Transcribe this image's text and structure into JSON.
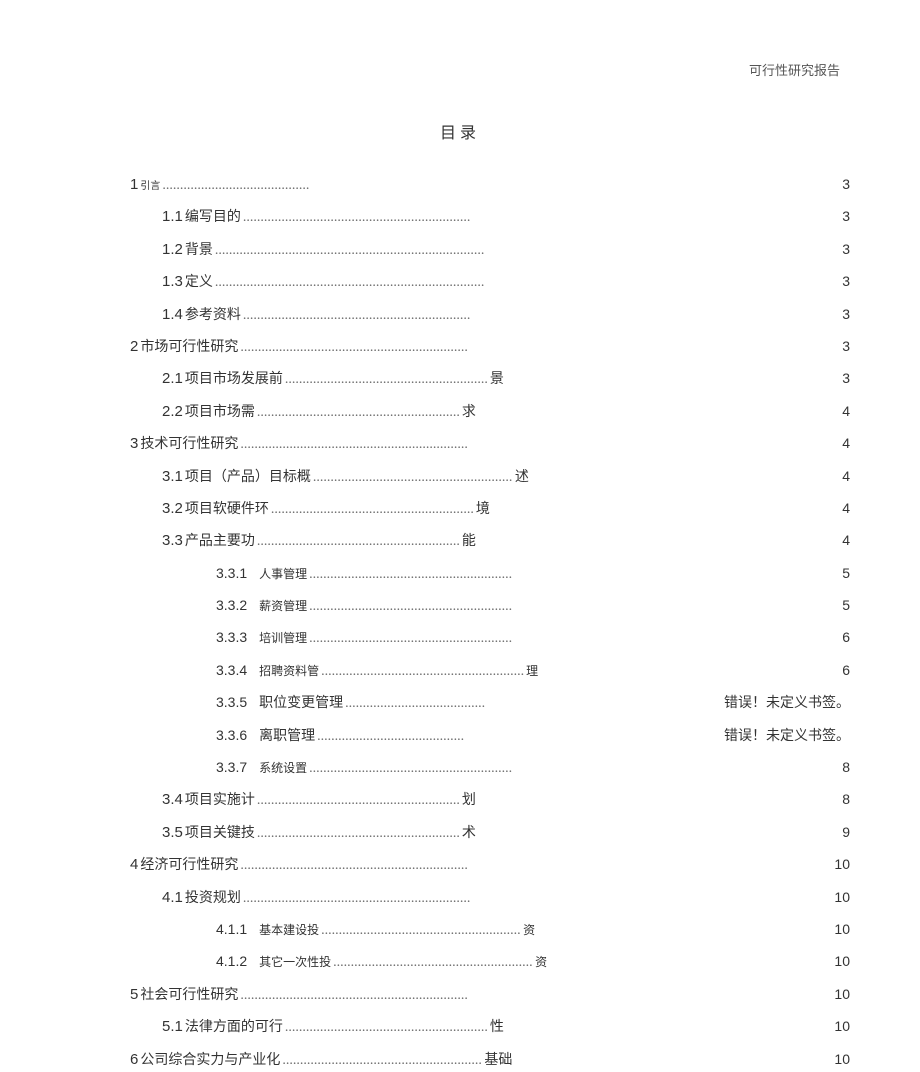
{
  "header": {
    "report_type": "可行性研究报告"
  },
  "title": "目录",
  "dots_short": "..........................................",
  "dots_med": "..........................................................",
  "dots_long": ".................................................................",
  "dots_xlong": ".............................................................................",
  "toc": {
    "i1": {
      "num": "1",
      "pre": "引言",
      "post": "",
      "page": "3"
    },
    "i11": {
      "num": "1.1",
      "pre": "编写目的",
      "post": "",
      "page": "3"
    },
    "i12": {
      "num": "1.2",
      "pre": "背景",
      "post": "",
      "page": "3"
    },
    "i13": {
      "num": "1.3",
      "pre": "定义",
      "post": "",
      "page": "3"
    },
    "i14": {
      "num": "1.4",
      "pre": "参考资料",
      "post": "",
      "page": "3"
    },
    "i2": {
      "num": "2",
      "pre": "市场可行性研究",
      "post": "",
      "page": "3"
    },
    "i21": {
      "num": "2.1",
      "pre": "项目市场发展前",
      "post": "景",
      "page": "3"
    },
    "i22": {
      "num": "2.2",
      "pre": "项目市场需",
      "post": "求",
      "page": "4"
    },
    "i3": {
      "num": "3",
      "pre": "技术可行性研究",
      "post": "",
      "page": "4"
    },
    "i31": {
      "num": "3.1",
      "pre": "项目（产品）目标概",
      "post": "述",
      "page": "4"
    },
    "i32": {
      "num": "3.2",
      "pre": "项目软硬件环",
      "post": "境",
      "page": "4"
    },
    "i33": {
      "num": "3.3",
      "pre": "产品主要功",
      "post": "能",
      "page": "4"
    },
    "i331": {
      "num": "3.3.1",
      "pre": "人事管理",
      "post": "",
      "page": "5"
    },
    "i332": {
      "num": "3.3.2",
      "pre": "薪资管理",
      "post": "",
      "page": "5"
    },
    "i333": {
      "num": "3.3.3",
      "pre": "培训管理",
      "post": "",
      "page": "6"
    },
    "i334": {
      "num": "3.3.4",
      "pre": "招聘资料管",
      "post": "理",
      "page": "6"
    },
    "i335": {
      "num": "3.3.5",
      "pre": "职位变更管理",
      "post": "",
      "page": "错误！未定义书签。"
    },
    "i336": {
      "num": "3.3.6",
      "pre": "离职管理",
      "post": "",
      "page": "错误！未定义书签。"
    },
    "i337": {
      "num": "3.3.7",
      "pre": "系统设置",
      "post": "",
      "page": "8"
    },
    "i34": {
      "num": "3.4",
      "pre": "项目实施计",
      "post": "划",
      "page": "8"
    },
    "i35": {
      "num": "3.5",
      "pre": "项目关键技",
      "post": "术",
      "page": "9"
    },
    "i4": {
      "num": "4",
      "pre": "经济可行性研究",
      "post": "",
      "page": "10"
    },
    "i41": {
      "num": "4.1",
      "pre": "投资规划",
      "post": "",
      "page": "10"
    },
    "i411": {
      "num": "4.1.1",
      "pre": "基本建设投",
      "post": "资",
      "page": "10"
    },
    "i412": {
      "num": "4.1.2",
      "pre": "其它一次性投",
      "post": "资",
      "page": "10"
    },
    "i5": {
      "num": "5",
      "pre": "社会可行性研究",
      "post": "",
      "page": "10"
    },
    "i51": {
      "num": "5.1",
      "pre": "法律方面的可行",
      "post": "性",
      "page": "10"
    },
    "i6": {
      "num": "6",
      "pre": "公司综合实力与产业化",
      "post": "基础",
      "page": "10"
    }
  }
}
